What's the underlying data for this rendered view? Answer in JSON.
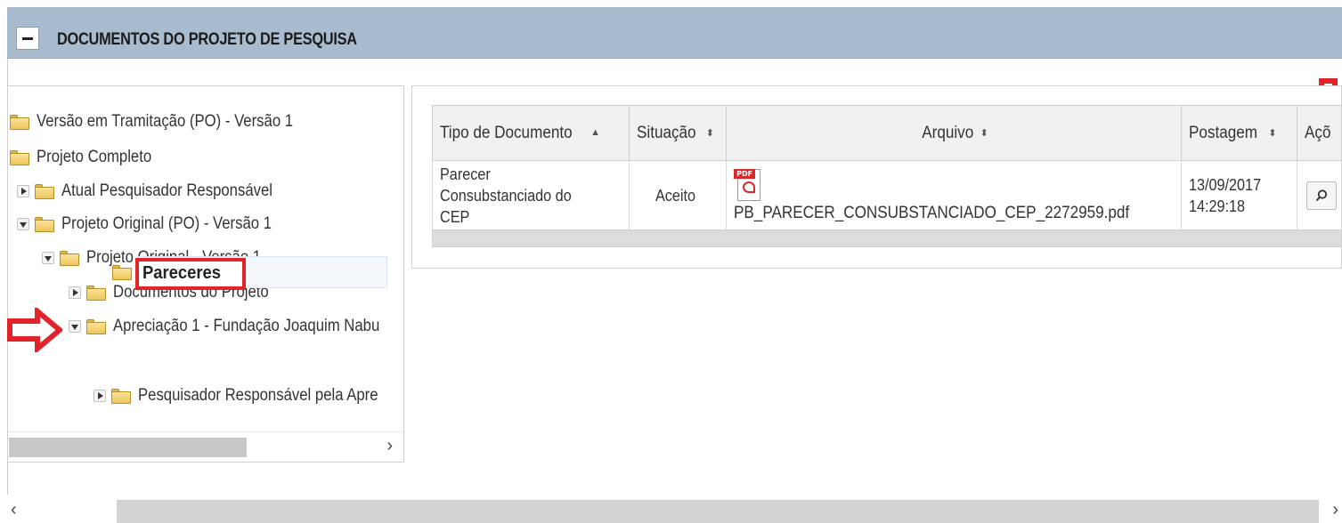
{
  "panel": {
    "toggle_symbol": "−",
    "title": "DOCUMENTOS DO PROJETO DE PESQUISA"
  },
  "tree": {
    "items": [
      {
        "label": "Versão em Tramitação (PO) - Versão 1"
      },
      {
        "label": "Projeto Completo"
      },
      {
        "label": "Atual Pesquisador Responsável"
      },
      {
        "label": "Projeto Original (PO) - Versão 1"
      },
      {
        "label": "Projeto Original - Versão 1"
      },
      {
        "label": "Documentos do Projeto"
      },
      {
        "label": "Apreciação 1 - Fundação Joaquim Nabu"
      },
      {
        "label": "Pareceres"
      },
      {
        "label": "Pesquisador Responsável pela Apre"
      }
    ],
    "scroll_right_symbol": "›"
  },
  "table": {
    "headers": {
      "tipo": "Tipo de Documento",
      "situacao": "Situação",
      "arquivo": "Arquivo",
      "postagem": "Postagem",
      "acoes": "Açõ"
    },
    "sort_up_symbol": "▲",
    "sort_both_symbol": "⬍",
    "rows": [
      {
        "tipo_line1": "Parecer",
        "tipo_line2": "Consubstanciado do CEP",
        "situacao": "Aceito",
        "arquivo": "PB_PARECER_CONSUBSTANCIADO_CEP_2272959.pdf",
        "postagem_date": "13/09/2017",
        "postagem_time": "14:29:18",
        "pdf_badge": "PDF"
      }
    ]
  },
  "scrollbar": {
    "left_symbol": "‹",
    "right_symbol": "›"
  },
  "colors": {
    "header_bg": "#a9bccf",
    "highlight_red": "#e0242a"
  },
  "icons": {
    "tree_folder": "folder-icon",
    "file": "pdf-icon",
    "action": "search-icon"
  }
}
